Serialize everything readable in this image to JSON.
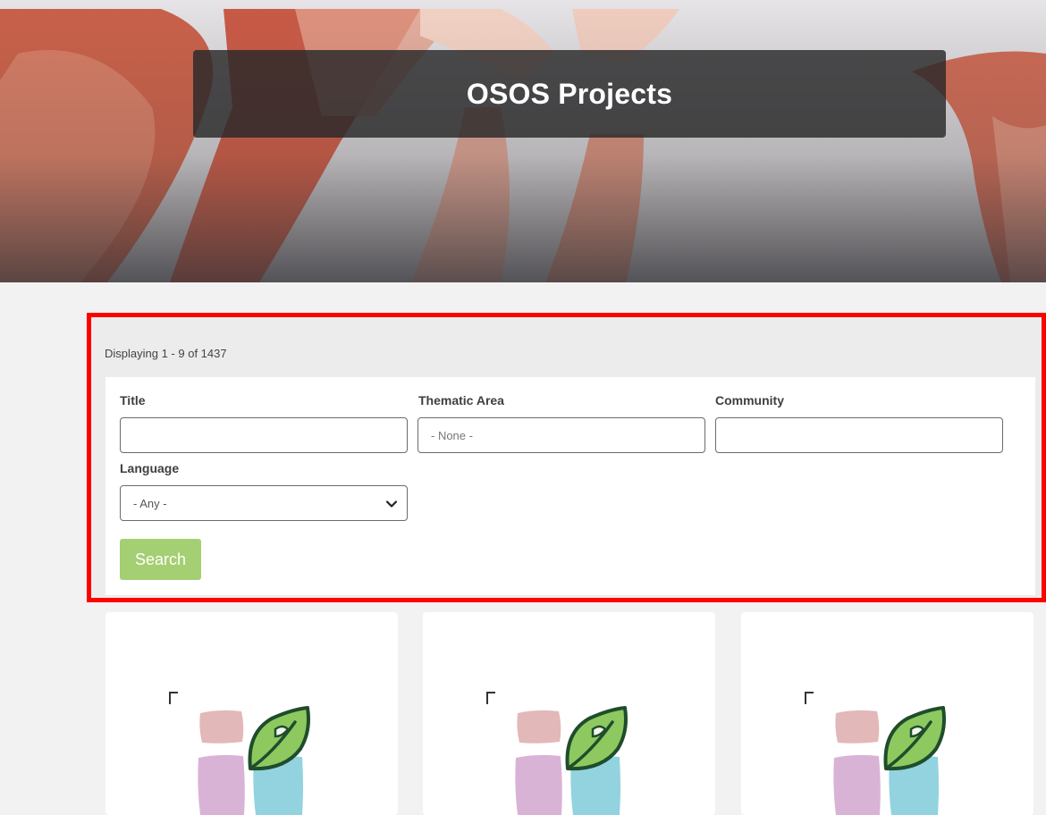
{
  "hero": {
    "title": "OSOS Projects"
  },
  "results": {
    "count_text": "Displaying 1 - 9 of 1437"
  },
  "filters": {
    "title": {
      "label": "Title",
      "value": "",
      "placeholder": ""
    },
    "thematic_area": {
      "label": "Thematic Area",
      "value": "",
      "placeholder": "- None -"
    },
    "community": {
      "label": "Community",
      "value": "",
      "placeholder": ""
    },
    "language": {
      "label": "Language",
      "selected": "- Any -"
    },
    "search_label": "Search"
  },
  "colors": {
    "accent_green": "#a4cf72",
    "highlight_border": "#ff0000",
    "hero_box": "#28282a"
  },
  "cards": [
    {
      "icon": "project-logo-icon"
    },
    {
      "icon": "project-logo-icon"
    },
    {
      "icon": "project-logo-icon"
    }
  ]
}
